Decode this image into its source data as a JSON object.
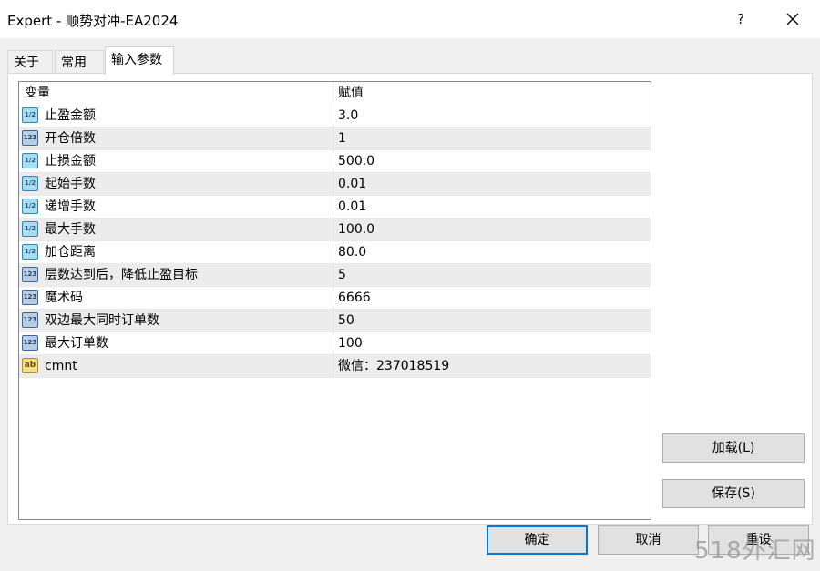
{
  "window": {
    "title": "Expert - 顺势对冲-EA2024",
    "help_glyph": "?",
    "close_label": "close"
  },
  "tabs": [
    {
      "label": "关于",
      "active": false
    },
    {
      "label": "常用",
      "active": false
    },
    {
      "label": "输入参数",
      "active": true
    }
  ],
  "grid": {
    "headers": {
      "variable": "变量",
      "value": "赋值"
    },
    "rows": [
      {
        "type_icon": "double-type-icon",
        "icon_text": "1/2",
        "name": "止盈金额",
        "value": "3.0"
      },
      {
        "type_icon": "int-type-icon",
        "icon_text": "123",
        "name": "开仓倍数",
        "value": "1"
      },
      {
        "type_icon": "double-type-icon",
        "icon_text": "1/2",
        "name": "止损金额",
        "value": "500.0"
      },
      {
        "type_icon": "double-type-icon",
        "icon_text": "1/2",
        "name": "起始手数",
        "value": "0.01"
      },
      {
        "type_icon": "double-type-icon",
        "icon_text": "1/2",
        "name": "递增手数",
        "value": "0.01"
      },
      {
        "type_icon": "double-type-icon",
        "icon_text": "1/2",
        "name": "最大手数",
        "value": "100.0"
      },
      {
        "type_icon": "double-type-icon",
        "icon_text": "1/2",
        "name": "加仓距离",
        "value": "80.0"
      },
      {
        "type_icon": "int-type-icon",
        "icon_text": "123",
        "name": "层数达到后，降低止盈目标",
        "value": "5"
      },
      {
        "type_icon": "int-type-icon",
        "icon_text": "123",
        "name": "魔术码",
        "value": "6666"
      },
      {
        "type_icon": "int-type-icon",
        "icon_text": "123",
        "name": "双边最大同时订单数",
        "value": "50"
      },
      {
        "type_icon": "int-type-icon",
        "icon_text": "123",
        "name": "最大订单数",
        "value": "100"
      },
      {
        "type_icon": "string-type-icon",
        "icon_text": "ab",
        "name": "cmnt",
        "value": "微信：237018519"
      }
    ]
  },
  "buttons": {
    "load": "加载(L)",
    "save": "保存(S)",
    "ok": "确定",
    "cancel": "取消",
    "reset": "重设"
  },
  "watermark": "518外汇网",
  "colors": {
    "accent": "#0078d7",
    "double_icon": "#a9dcef",
    "int_icon": "#b8cde0",
    "string_icon": "#f1e08a"
  }
}
